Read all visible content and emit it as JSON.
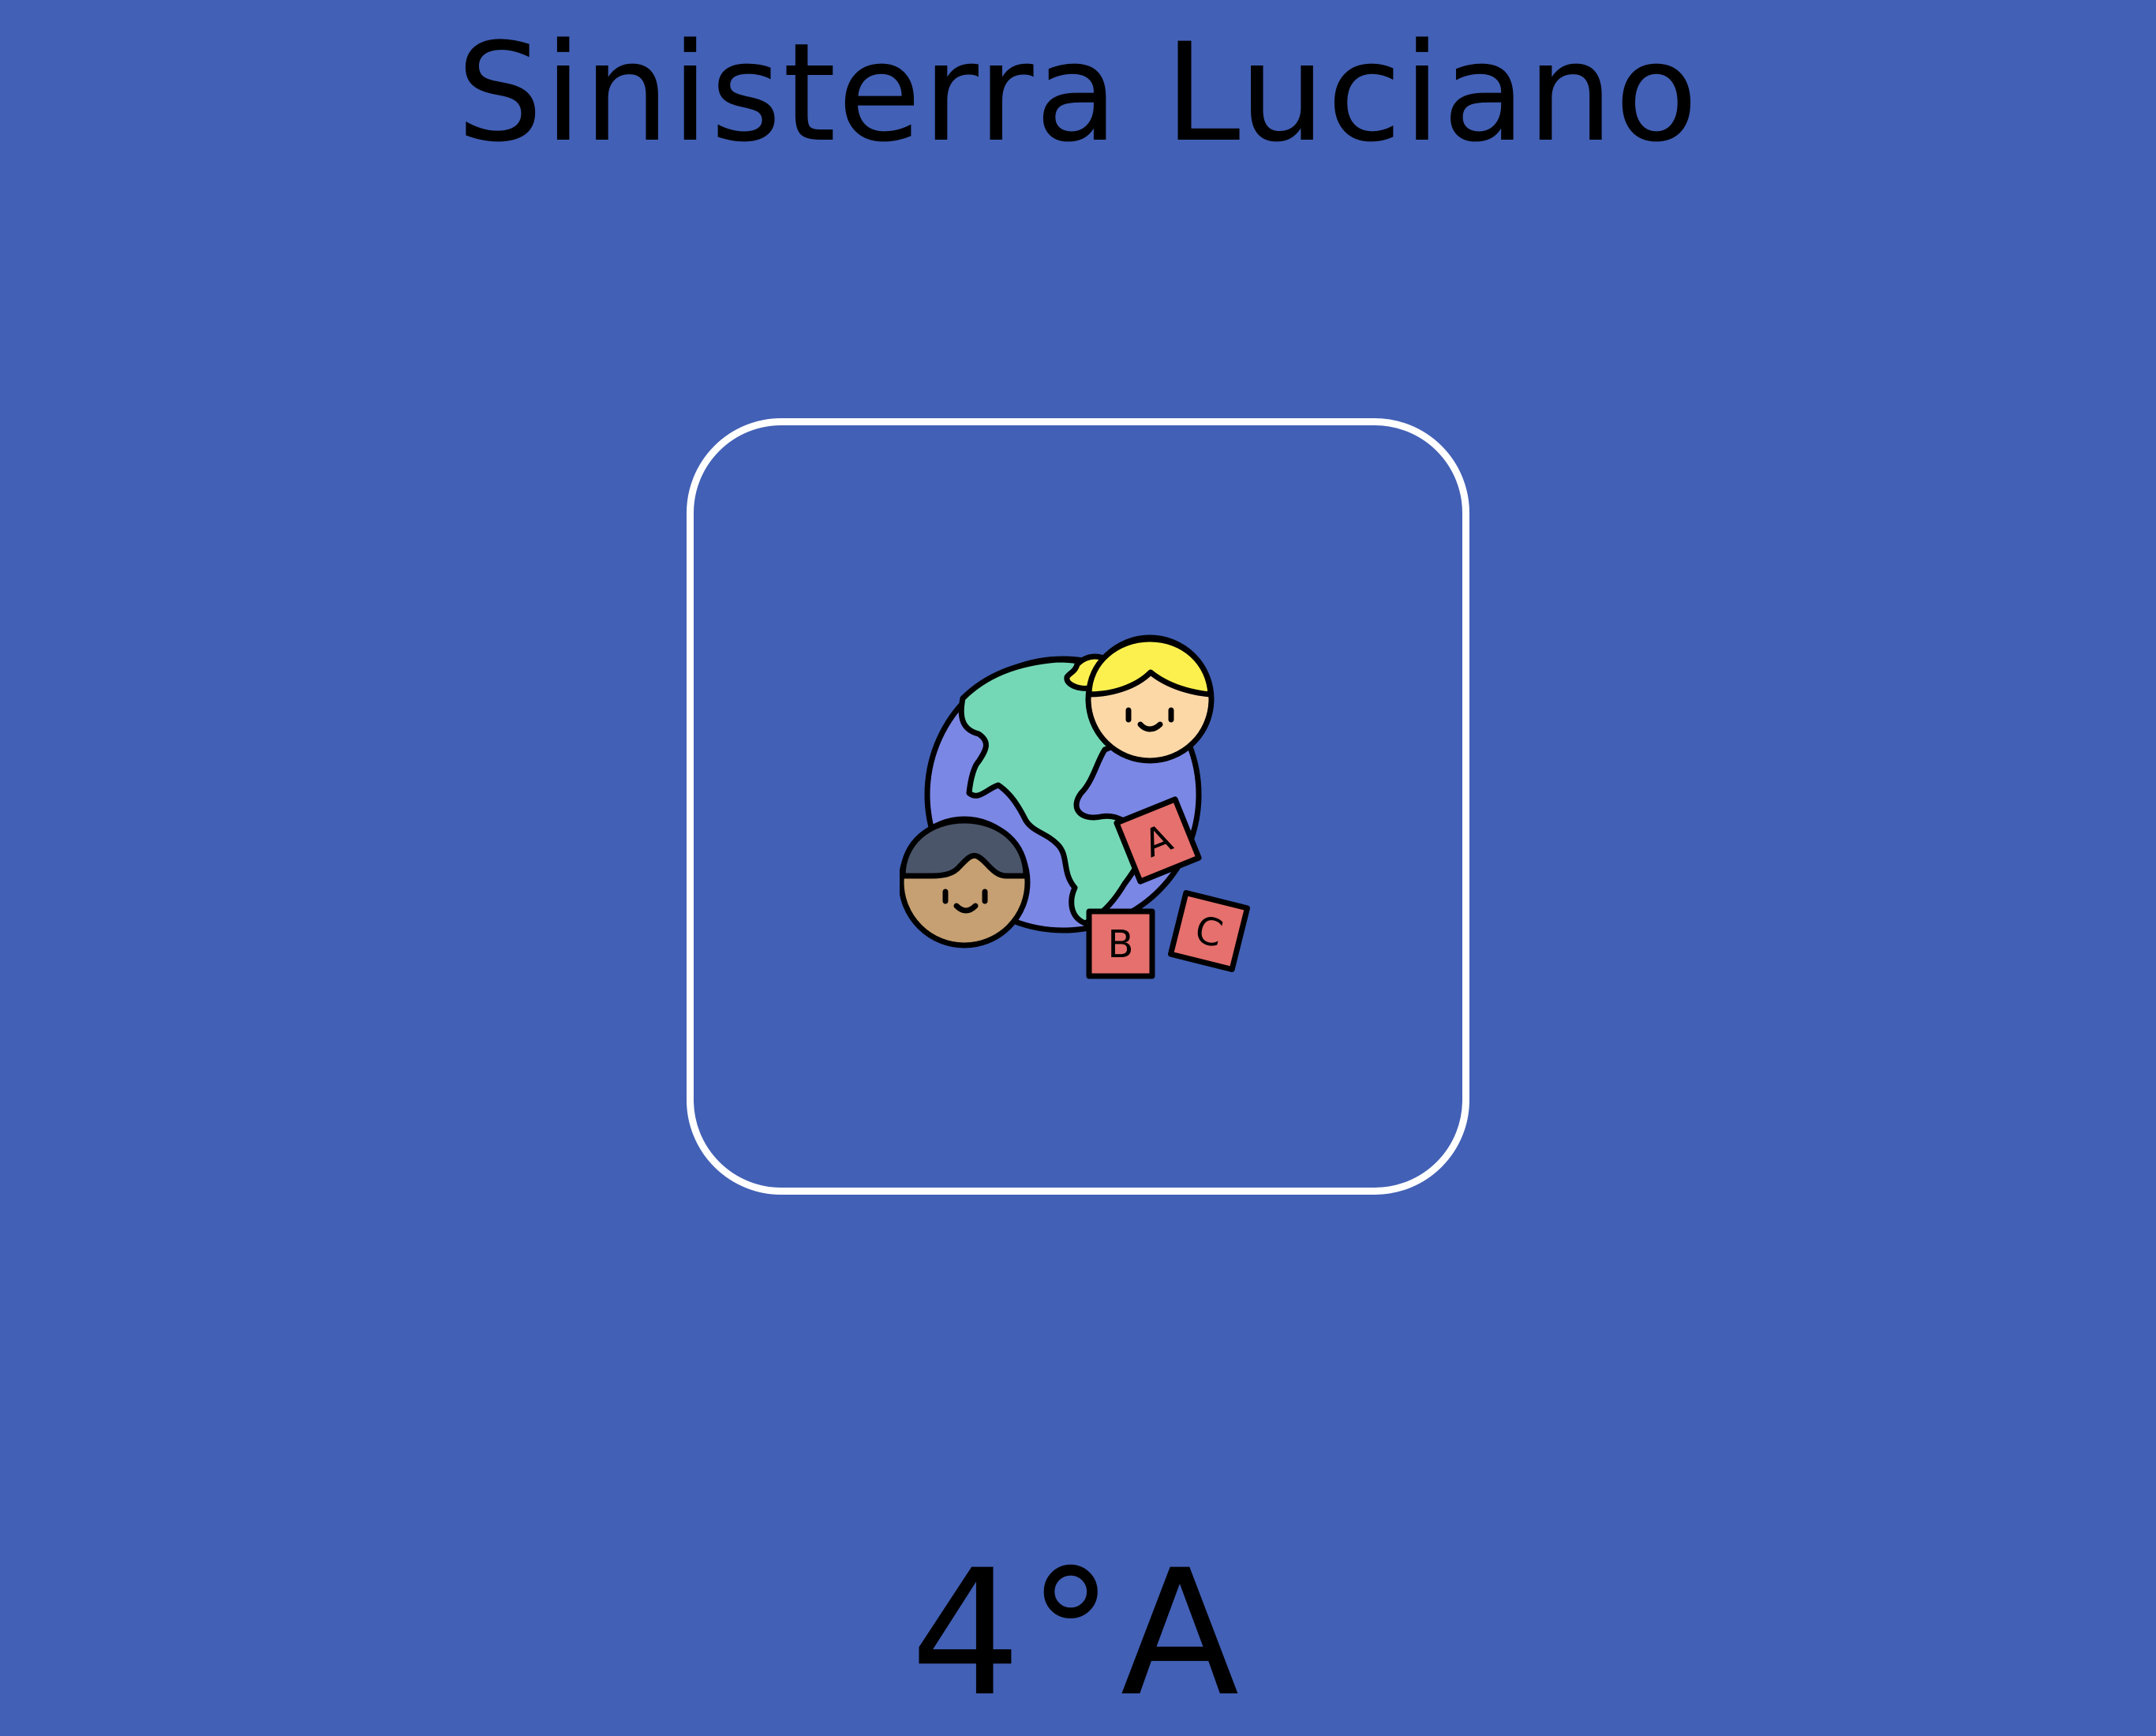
{
  "header": {
    "title": "Sinisterra Luciano"
  },
  "activity_card": {
    "icon": "kids-world-abc-blocks-icon",
    "blocks": {
      "a": "A",
      "b": "B",
      "c": "C"
    }
  },
  "footer": {
    "text": "4°A"
  },
  "colors": {
    "background": "#4260b5",
    "card_border": "#ffffff",
    "ocean": "#7b87e5",
    "land": "#74d8b6",
    "hair_blonde": "#fbf04e",
    "skin_light": "#fdd8a7",
    "skin_dark": "#c6a072",
    "hair_dark": "#4a5569",
    "block_red": "#e5706d"
  }
}
